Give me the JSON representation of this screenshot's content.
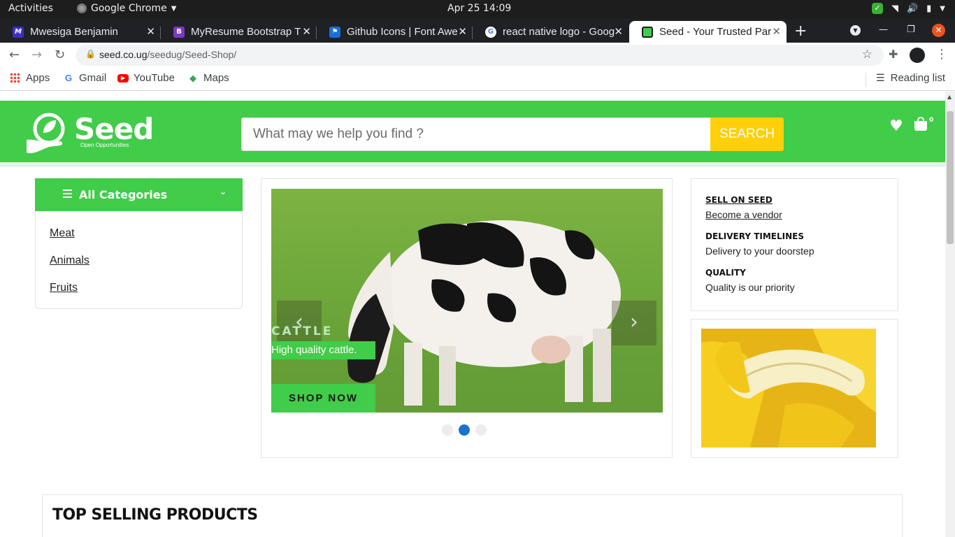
{
  "system": {
    "activities": "Activities",
    "app_name": "Google Chrome",
    "clock": "Apr 25  14:09"
  },
  "browser": {
    "tabs": [
      {
        "title": "Mwesiga Benjamin",
        "favicon": "M",
        "color": "#3b2fc7"
      },
      {
        "title": "MyResume Bootstrap T",
        "favicon": "B",
        "color": "#7a39c6"
      },
      {
        "title": "Github Icons | Font Awe",
        "favicon": "flag",
        "color": "#1a6ed8"
      },
      {
        "title": "react native logo - Goog",
        "favicon": "G",
        "color": "#ffffff"
      },
      {
        "title": "Seed - Your Trusted Par",
        "favicon": "seed",
        "color": "#41cc49"
      }
    ],
    "url_host": "seed.co.ug",
    "url_path": "/seedug/Seed-Shop/",
    "bookmarks": [
      "Apps",
      "Gmail",
      "YouTube",
      "Maps"
    ],
    "reading_list": "Reading list"
  },
  "site": {
    "brand": "Seed",
    "tagline": "Open Opportunities",
    "brand_color": "#41cc49",
    "search_placeholder": "What may we help you find ?",
    "search_button": "SEARCH",
    "cart_count": "0",
    "categories": {
      "title": "All Categories",
      "items": [
        "Meat",
        "Animals",
        "Fruits"
      ]
    },
    "slide": {
      "title": "CATTLE",
      "subtitle": "High quality cattle.",
      "button": "SHOP NOW",
      "active_index": 1,
      "total": 3
    },
    "info": [
      {
        "heading": "SELL ON SEED",
        "text": "Become a vendor"
      },
      {
        "heading": "DELIVERY TIMELINES",
        "text": "Delivery to your doorstep"
      },
      {
        "heading": "QUALITY",
        "text": "Quality is our priority"
      }
    ],
    "section_title": "TOP SELLING PRODUCTS"
  }
}
